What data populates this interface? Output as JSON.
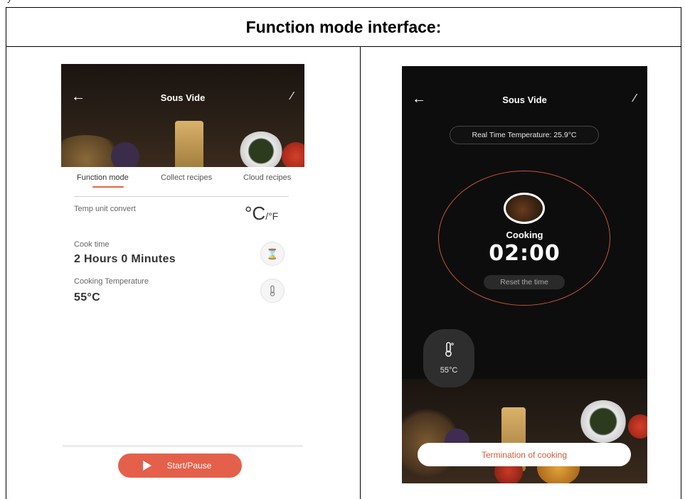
{
  "document": {
    "top_text": "y",
    "title": "Function mode interface:"
  },
  "left_screen": {
    "header_title": "Sous Vide",
    "tabs": [
      {
        "label": "Function mode",
        "active": true
      },
      {
        "label": "Collect recipes",
        "active": false
      },
      {
        "label": "Cloud recipes",
        "active": false
      }
    ],
    "temp_unit_label": "Temp unit convert",
    "temp_unit_main": "°C",
    "temp_unit_sep": "/°F",
    "cook_time_label": "Cook time",
    "cook_time_value": "2 Hours 0 Minutes",
    "cooking_temp_label": "Cooking Temperature",
    "cooking_temp_value": "55°C",
    "start_button": "Start/Pause",
    "accent_color": "#e4604a"
  },
  "right_screen": {
    "header_title": "Sous Vide",
    "real_time_temp": "Real Time Temperature: 25.9°C",
    "status": "Cooking",
    "timer": "02:00",
    "reset_label": "Reset the time",
    "temp_card_value": "55°C",
    "termination_button": "Termination of cooking",
    "ring_color": "#c8543b"
  },
  "icons": {
    "back": "back-arrow-icon",
    "edit": "edit-pencil-icon",
    "hourglass": "hourglass-icon",
    "thermometer": "thermometer-icon",
    "play": "play-icon"
  }
}
